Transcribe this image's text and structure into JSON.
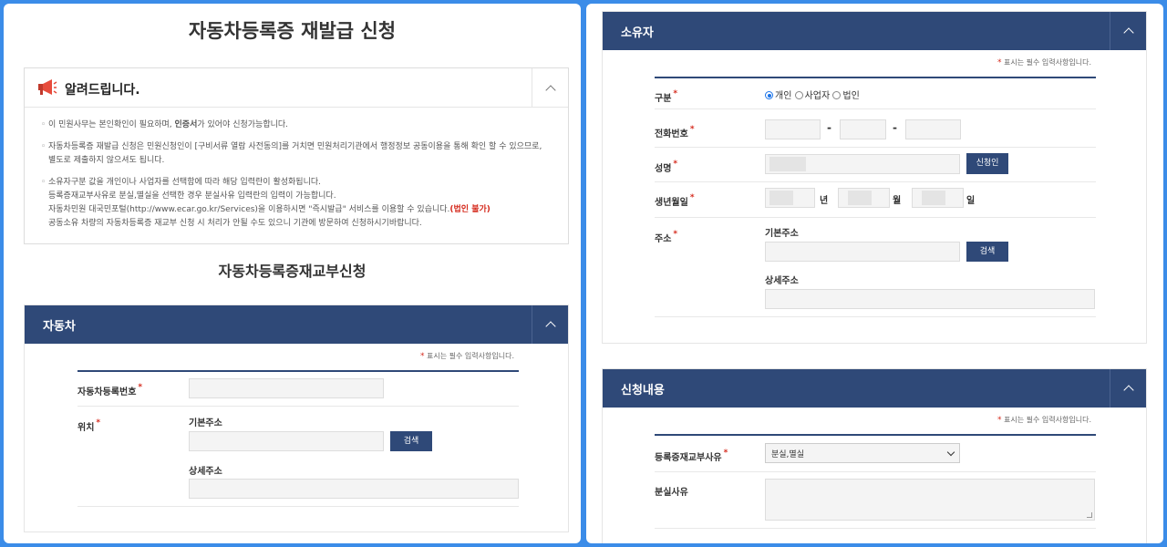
{
  "left": {
    "title": "자동차등록증 재발급 신청",
    "notice": {
      "heading": "알려드립니다.",
      "line1_pre": "이 민원사무는 본인확인이 필요하며, ",
      "line1_bold": "인증서",
      "line1_post": "가 있어야 신청가능합니다.",
      "line2": "자동차등록증 재발급 신청은 민원신청인이 [구비서류 열람 사전동의]를 거치면 민원처리기관에서 행정정보 공동이용을 통해 확인 할 수 있으므로, 별도로 제출하지 않으셔도 됩니다.",
      "line3a": "소유자구분 값을 개인이나 사업자를 선택함에 따라 해당 입력란이 활성화됩니다.",
      "line3b": "등록증재교부사유로 분실,멸실을 선택한 경우 분실사유 입력란의 입력이 가능합니다.",
      "line3c_pre": "자동차민원 대국민포털(http://www.ecar.go.kr/Services)을 이용하시면 \"즉시발급\" 서비스를 이용할 수 있습니다.",
      "line3c_red": "(법인 불가)",
      "line3d": "공동소유 차량의 자동차등록증 재교부 신청 시 처리가 안될 수도 있으니 기관에 방문하여 신청하시기바랍니다."
    },
    "form_title": "자동차등록증재교부신청",
    "vehicle_section": {
      "title": "자동차",
      "required_note": "표시는 필수 입력사항입니다.",
      "reg_no_label": "자동차등록번호",
      "location_label": "위치",
      "basic_address_label": "기본주소",
      "search_button": "검색",
      "detail_address_label": "상세주소"
    }
  },
  "right": {
    "owner_section": {
      "title": "소유자",
      "required_note": "표시는 필수 입력사항입니다.",
      "type_label": "구분",
      "type_options": [
        "개인",
        "사업자",
        "법인"
      ],
      "type_selected": "개인",
      "phone_label": "전화번호",
      "phone_sep": "-",
      "name_label": "성명",
      "applicant_button": "신청인",
      "birth_label": "생년월일",
      "year_unit": "년",
      "month_unit": "월",
      "day_unit": "일",
      "address_label": "주소",
      "basic_address_label": "기본주소",
      "search_button": "검색",
      "detail_address_label": "상세주소"
    },
    "request_section": {
      "title": "신청내용",
      "required_note": "표시는 필수 입력사항입니다.",
      "reason_label": "등록증재교부사유",
      "reason_selected": "분실,멸실",
      "loss_reason_label": "분실사유"
    }
  },
  "colors": {
    "background": "#3b8ce8",
    "section_header": "#2f4978",
    "required_mark": "#d52b1e"
  },
  "icons": {
    "notice_icon": "megaphone-icon",
    "collapse_icon": "chevron-up-icon"
  }
}
